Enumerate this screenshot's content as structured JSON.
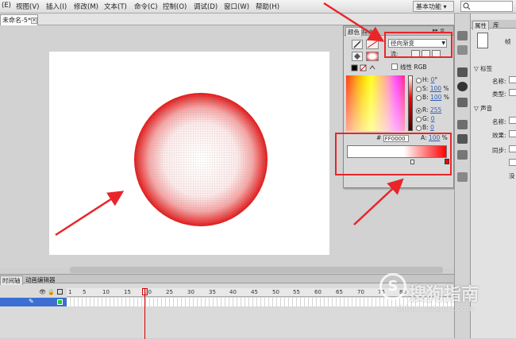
{
  "menu": {
    "items": [
      "(E)",
      "视图(V)",
      "插入(I)",
      "修改(M)",
      "文本(T)",
      "命令(C)",
      "控制(O)",
      "调试(D)",
      "窗口(W)",
      "帮助(H)"
    ],
    "workspace": "基本功能"
  },
  "document": {
    "tab_label": "未命名-5*"
  },
  "color_panel": {
    "tab_color": "颜色",
    "tab_swatches": "样本",
    "fill_type": "径向渐变",
    "flow_label": "流:",
    "linear_rgb_label": "线性 RGB",
    "hsb": [
      {
        "label": "H:",
        "value": "0",
        "unit": "°"
      },
      {
        "label": "S:",
        "value": "100",
        "unit": "%"
      },
      {
        "label": "B:",
        "value": "100",
        "unit": "%"
      }
    ],
    "rgb": [
      {
        "label": "R:",
        "value": "255"
      },
      {
        "label": "G:",
        "value": "0"
      },
      {
        "label": "B:",
        "value": "0"
      }
    ],
    "hex_label": "#",
    "hex_value": "FF0000",
    "alpha_label": "A:",
    "alpha_value": "100",
    "alpha_unit": "%"
  },
  "properties": {
    "tab_properties": "属性",
    "tab_library": "库",
    "label_frame": "帧",
    "section_label": "标签",
    "name_label": "名称:",
    "type_label": "类型:",
    "section_sound": "声音",
    "sound_name_label": "名称:",
    "effect_label": "效果:",
    "sync_label": "同步:",
    "bottom_text": "没"
  },
  "timeline": {
    "tab_timeline": "时间轴",
    "tab_motion_editor": "动画编辑器",
    "frame_numbers": [
      "1",
      "5",
      "10",
      "15",
      "20",
      "25",
      "30",
      "35",
      "40",
      "45",
      "50",
      "55",
      "60",
      "65",
      "70",
      "75",
      "80"
    ]
  },
  "watermark": {
    "logo": "S",
    "text": "搜狗指南",
    "url": "zhinan.sogou.com"
  },
  "colors": {
    "annotation_red": "#e8262a",
    "gradient_start": "#ffffff",
    "gradient_end": "#ff0000",
    "layer_selected": "#3c6fd1"
  }
}
